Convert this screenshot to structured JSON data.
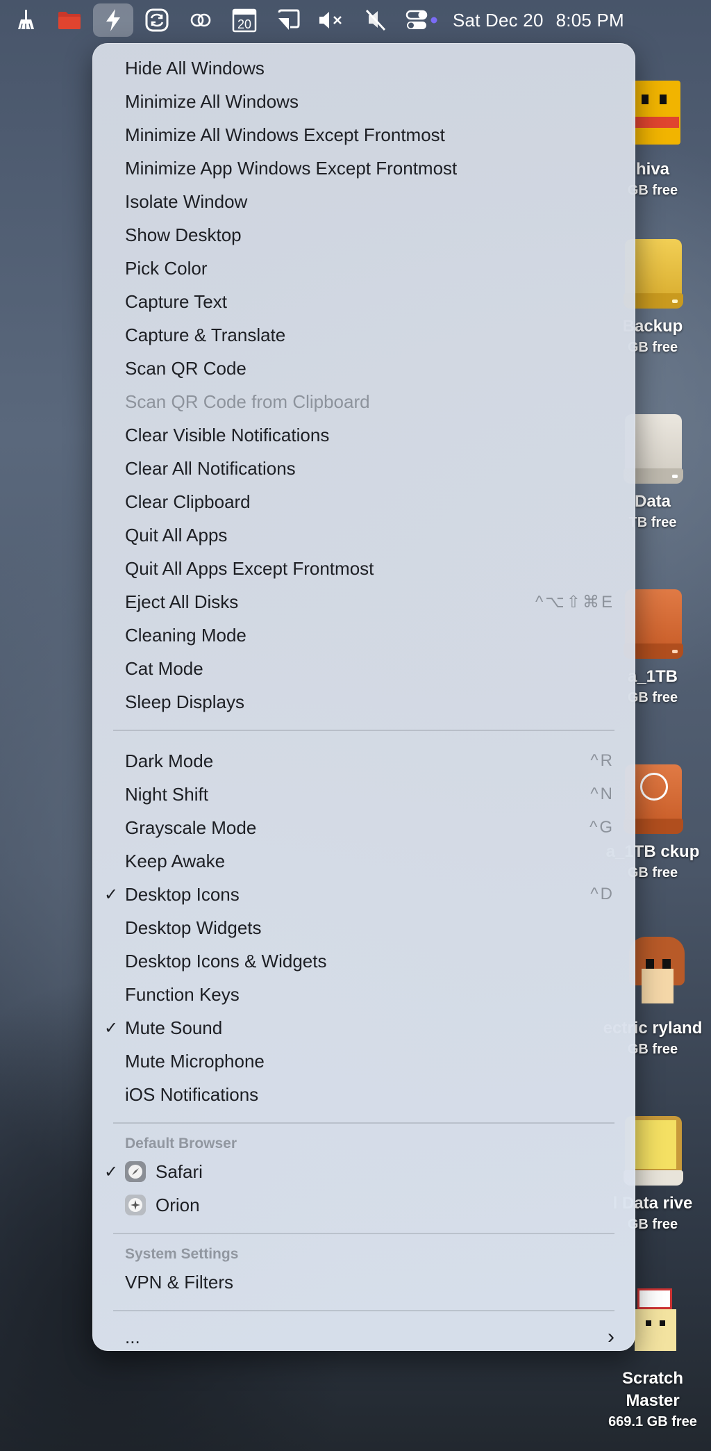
{
  "menubar": {
    "icons": [
      {
        "name": "broom-icon"
      },
      {
        "name": "folder-icon"
      },
      {
        "name": "lightning-bolt-icon"
      },
      {
        "name": "sync-arrows-icon"
      },
      {
        "name": "eyeglasses-icon"
      },
      {
        "name": "calendar-date-icon",
        "text": "20"
      },
      {
        "name": "cast-icon"
      },
      {
        "name": "speaker-muted-icon"
      },
      {
        "name": "mic-off-icon"
      },
      {
        "name": "control-center-icon"
      }
    ],
    "date": "Sat Dec 20",
    "time": "8:05 PM"
  },
  "menu": {
    "group1": [
      {
        "label": "Hide All Windows"
      },
      {
        "label": "Minimize All Windows"
      },
      {
        "label": "Minimize All Windows Except Frontmost"
      },
      {
        "label": "Minimize App Windows Except Frontmost"
      },
      {
        "label": "Isolate Window"
      },
      {
        "label": "Show Desktop"
      },
      {
        "label": "Pick Color"
      },
      {
        "label": "Capture Text"
      },
      {
        "label": "Capture & Translate"
      },
      {
        "label": "Scan QR Code"
      },
      {
        "label": "Scan QR Code from Clipboard",
        "disabled": true
      },
      {
        "label": "Clear Visible Notifications"
      },
      {
        "label": "Clear All Notifications"
      },
      {
        "label": "Clear Clipboard"
      },
      {
        "label": "Quit All Apps"
      },
      {
        "label": "Quit All Apps Except Frontmost"
      },
      {
        "label": "Eject All Disks",
        "shortcut": "^⌥⇧⌘E"
      },
      {
        "label": "Cleaning Mode"
      },
      {
        "label": "Cat Mode"
      },
      {
        "label": "Sleep Displays"
      }
    ],
    "group2": [
      {
        "label": "Dark Mode",
        "shortcut": "^R"
      },
      {
        "label": "Night Shift",
        "shortcut": "^N"
      },
      {
        "label": "Grayscale Mode",
        "shortcut": "^G"
      },
      {
        "label": "Keep Awake"
      },
      {
        "label": "Desktop Icons",
        "shortcut": "^D",
        "checked": true
      },
      {
        "label": "Desktop Widgets"
      },
      {
        "label": "Desktop Icons & Widgets"
      },
      {
        "label": "Function Keys"
      },
      {
        "label": "Mute Sound",
        "checked": true
      },
      {
        "label": "Mute Microphone"
      },
      {
        "label": "iOS Notifications"
      }
    ],
    "browser_section": {
      "title": "Default Browser",
      "items": [
        {
          "label": "Safari",
          "checked": true,
          "icon": "safari-icon"
        },
        {
          "label": "Orion",
          "checked": false,
          "icon": "orion-icon"
        }
      ]
    },
    "settings_section": {
      "title": "System Settings",
      "items": [
        {
          "label": "VPN & Filters"
        }
      ]
    },
    "more": {
      "label": "...",
      "chevron": "›"
    }
  },
  "desktop": {
    "disks": [
      {
        "name": "hiva",
        "free": "GB free"
      },
      {
        "name": "Backup",
        "free": "GB free"
      },
      {
        "name": "Data",
        "free": "TB free"
      },
      {
        "name": "a_1TB",
        "free": "GB free"
      },
      {
        "name": "a_1TB ckup",
        "free": "GB free"
      },
      {
        "name": "ectric ryland",
        "free": "GB free"
      },
      {
        "name": "l Data rive",
        "free": "GB free"
      },
      {
        "name": "Scratch Master",
        "free": "669.1 GB free"
      }
    ]
  },
  "colors": {
    "menu_text": "#1d1f24",
    "menu_secondary": "#8d939c",
    "status_dot": "#7b6cf6"
  }
}
